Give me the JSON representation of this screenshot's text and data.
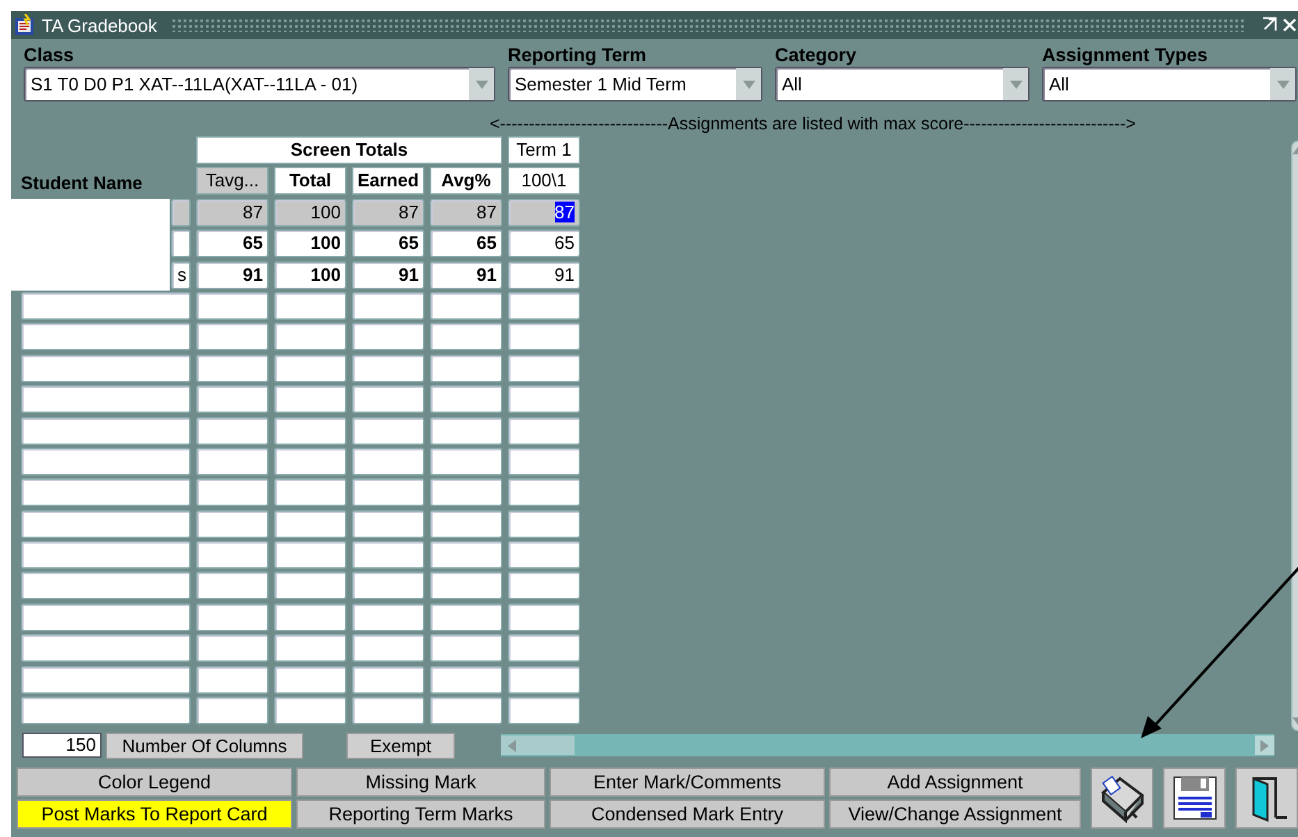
{
  "window": {
    "title": "TA Gradebook"
  },
  "filters": [
    {
      "label": "Class",
      "value": "S1 T0 D0 P1 XAT--11LA(XAT--11LA - 01)"
    },
    {
      "label": "Reporting Term",
      "value": "Semester 1 Mid Term"
    },
    {
      "label": "Category",
      "value": "All"
    },
    {
      "label": "Assignment Types",
      "value": "All"
    }
  ],
  "assignments_note": "<-----------------------------Assignments are listed with max score---------------------------->",
  "table": {
    "name_header": "Student Name",
    "totals_header": "Screen Totals",
    "term_header": "Term 1",
    "term_max": "100\\1",
    "columns": [
      {
        "label": "Tavg...",
        "selected": true
      },
      {
        "label": "Total",
        "selected": false
      },
      {
        "label": "Earned",
        "selected": false
      },
      {
        "label": "Avg%",
        "selected": false
      }
    ],
    "rows": [
      {
        "name": "",
        "selected": true,
        "totals": [
          "87",
          "100",
          "87",
          "87"
        ],
        "term": "87",
        "term_highlighted": true
      },
      {
        "name": "",
        "selected": false,
        "totals": [
          "65",
          "100",
          "65",
          "65"
        ],
        "term": "65",
        "term_highlighted": false
      },
      {
        "name": "s",
        "selected": false,
        "totals": [
          "91",
          "100",
          "91",
          "91"
        ],
        "term": "91",
        "term_highlighted": false
      }
    ]
  },
  "number_of_columns": {
    "value": "150",
    "label": "Number Of Columns"
  },
  "exempt_button": "Exempt",
  "buttons": [
    {
      "label": "Color Legend",
      "color": "#c8c8c8"
    },
    {
      "label": "Missing Mark",
      "color": "#c8c8c8"
    },
    {
      "label": "Enter Mark/Comments",
      "color": "#c8c8c8"
    },
    {
      "label": "Add Assignment",
      "color": "#c8c8c8"
    },
    {
      "label": "Post Marks To Report Card",
      "color": "#ffff00"
    },
    {
      "label": "Reporting Term Marks",
      "color": "#c8c8c8"
    },
    {
      "label": "Condensed Mark Entry",
      "color": "#c8c8c8"
    },
    {
      "label": "View/Change Assignment",
      "color": "#c8c8c8"
    }
  ],
  "tool_buttons": [
    {
      "kind": "print"
    },
    {
      "kind": "save"
    },
    {
      "kind": "exit"
    }
  ]
}
